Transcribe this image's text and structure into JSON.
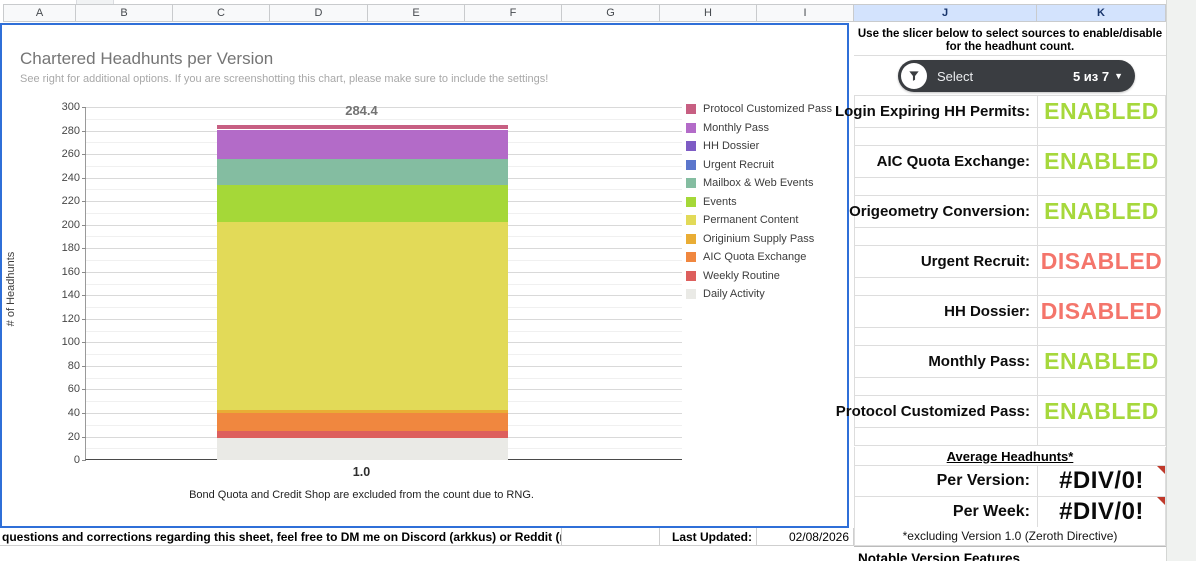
{
  "colors": {
    "enabled": "#a6d83c",
    "disabled": "#f4756b",
    "selection_border": "#2f6fd8",
    "header_selected_bg": "#d3e3fd",
    "slicer_bg": "#3a3d41"
  },
  "spreadsheet": {
    "column_headers": [
      "A",
      "B",
      "C",
      "D",
      "E",
      "F",
      "G",
      "H",
      "I",
      "J",
      "K"
    ],
    "selected_columns": [
      "J",
      "K"
    ],
    "footer": {
      "note": "questions and corrections regarding this sheet, feel free to DM me on Discord (arkkus) or Reddit (r/arkkus)!",
      "last_updated_label": "Last Updated:",
      "last_updated_value": "02/08/2026"
    }
  },
  "chart": {
    "title": "Chartered Headhunts per Version",
    "subtitle": "See right for additional options. If you are screenshotting this chart, please make sure to include the settings!",
    "y_axis_title": "# of Headhunts",
    "total_label": "284.4",
    "x_category": "1.0",
    "footnote": "Bond Quota and Credit Shop are excluded from the count due to RNG."
  },
  "chart_data": {
    "type": "bar",
    "stacked": true,
    "title": "Chartered Headhunts per Version",
    "subtitle": "See right for additional options. If you are screenshotting this chart, please make sure to include the settings!",
    "categories": [
      "1.0"
    ],
    "xlabel": "",
    "ylabel": "# of Headhunts",
    "ylim": [
      0,
      300
    ],
    "y_major_step": 20,
    "y_minor_step": 10,
    "grid": true,
    "legend_position": "right",
    "bar_total_label": 284.4,
    "series_top_to_bottom": [
      {
        "name": "Protocol Customized Pass",
        "value": 3.5,
        "color": "#c75f82"
      },
      {
        "name": "Monthly Pass",
        "value": 25,
        "color": "#b36bc8"
      },
      {
        "name": "HH Dossier",
        "value": 0,
        "color": "#7e5cc5"
      },
      {
        "name": "Urgent Recruit",
        "value": 0,
        "color": "#5b76cc"
      },
      {
        "name": "Mailbox & Web Events",
        "value": 22,
        "color": "#84bda1"
      },
      {
        "name": "Events",
        "value": 31.5,
        "color": "#a5d838"
      },
      {
        "name": "Permanent Content",
        "value": 160,
        "color": "#e2da58"
      },
      {
        "name": "Originium Supply Pass",
        "value": 2.5,
        "color": "#e9ad35"
      },
      {
        "name": "AIC Quota Exchange",
        "value": 15.4,
        "color": "#f0873f"
      },
      {
        "name": "Weekly Routine",
        "value": 6,
        "color": "#dd5f5d"
      },
      {
        "name": "Daily Activity",
        "value": 18.5,
        "color": "#eaeae6"
      }
    ]
  },
  "slicer_panel": {
    "instruction": "Use the slicer below to select sources to enable/disable for the headhunt count.",
    "slicer": {
      "label": "Select",
      "count": "5 из 7"
    },
    "settings": [
      {
        "label": "Login Expiring HH Permits:",
        "status": "ENABLED"
      },
      {
        "label": "AIC Quota Exchange:",
        "status": "ENABLED"
      },
      {
        "label": "Origeometry Conversion:",
        "status": "ENABLED"
      },
      {
        "label": "Urgent Recruit:",
        "status": "DISABLED"
      },
      {
        "label": "HH Dossier:",
        "status": "DISABLED"
      },
      {
        "label": "Monthly Pass:",
        "status": "ENABLED"
      },
      {
        "label": "Protocol Customized Pass:",
        "status": "ENABLED"
      }
    ],
    "averages": {
      "heading": "Average Headhunts*",
      "rows": [
        {
          "label": "Per Version:",
          "value": "#DIV/0!"
        },
        {
          "label": "Per Week:",
          "value": "#DIV/0!"
        }
      ],
      "footnote": "*excluding Version 1.0 (Zeroth Directive)"
    },
    "next_section_title": "Notable Version Features"
  }
}
